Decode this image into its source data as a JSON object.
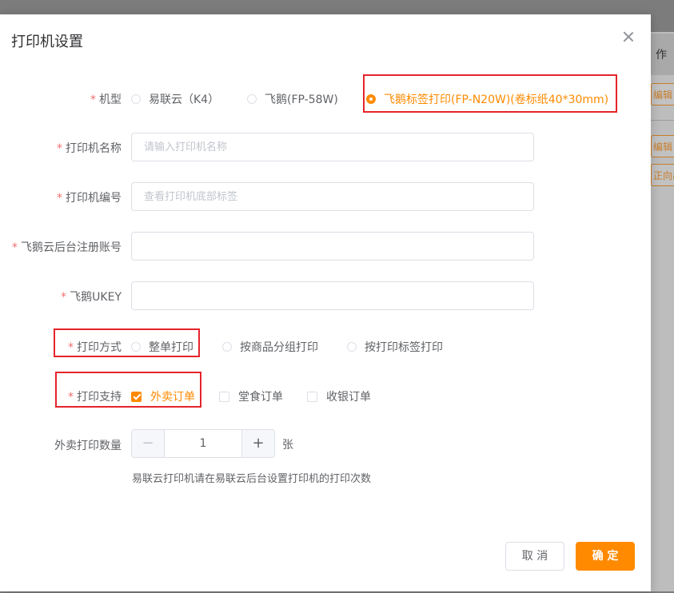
{
  "background": {
    "header_text": "作",
    "buttons": [
      "编辑",
      "编辑",
      "正向出"
    ]
  },
  "dialog": {
    "title": "打印机设置",
    "close_icon": "close-icon"
  },
  "form": {
    "model": {
      "label": "机型",
      "options": [
        {
          "label": "易联云（K4）",
          "checked": false
        },
        {
          "label": "飞鹅(FP-58W)",
          "checked": false
        },
        {
          "label": "飞鹅标签打印(FP-N20W)(卷标纸40*30mm)",
          "checked": true
        }
      ]
    },
    "printer_name": {
      "label": "打印机名称",
      "placeholder": "请输入打印机名称",
      "value": ""
    },
    "printer_sn": {
      "label": "打印机编号",
      "placeholder": "查看打印机底部标签",
      "value": ""
    },
    "feie_account": {
      "label": "飞鹅云后台注册账号",
      "placeholder": "",
      "value": ""
    },
    "feie_ukey": {
      "label": "飞鹅UKEY",
      "placeholder": "",
      "value": ""
    },
    "print_mode": {
      "label": "打印方式",
      "options": [
        {
          "label": "整单打印",
          "checked": false
        },
        {
          "label": "按商品分组打印",
          "checked": false
        },
        {
          "label": "按打印标签打印",
          "checked": false
        }
      ]
    },
    "print_support": {
      "label": "打印支持",
      "options": [
        {
          "label": "外卖订单",
          "checked": true
        },
        {
          "label": "堂食订单",
          "checked": false
        },
        {
          "label": "收银订单",
          "checked": false
        }
      ]
    },
    "takeout_count": {
      "label": "外卖打印数量",
      "minus": "−",
      "value": "1",
      "plus": "+",
      "unit": "张",
      "hint": "易联云打印机请在易联云后台设置打印机的打印次数"
    },
    "required_mark": "*"
  },
  "footer": {
    "cancel_label": "取 消",
    "ok_label": "确 定"
  },
  "colors": {
    "accent": "#ff8a00",
    "required": "#f56c6c",
    "highlight_box": "#e5242b"
  }
}
